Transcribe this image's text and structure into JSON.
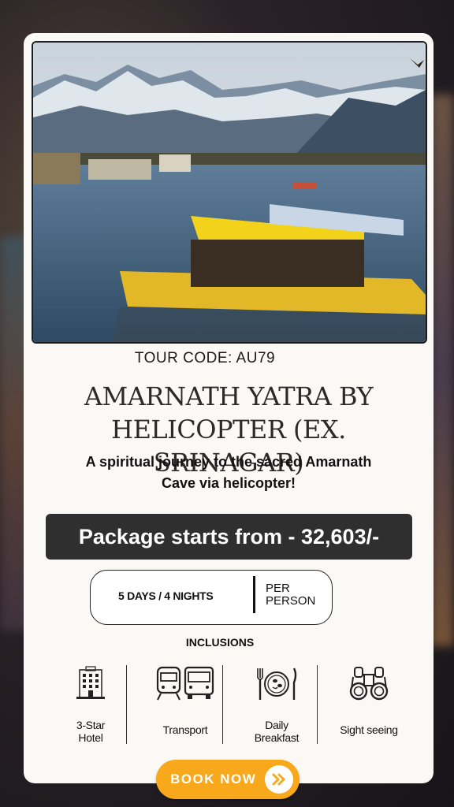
{
  "tour_code": "TOUR CODE: AU79",
  "title_line1": "AMARNATH YATRA BY",
  "title_line2": "HELICOPTER (EX. SRINAGAR)",
  "subtitle_line1": "A spiritual journey to the sacred Amarnath",
  "subtitle_line2": "Cave via helicopter!",
  "price_text": "Package starts from - 32,603/-",
  "duration": "5 DAYS / 4 NIGHTS",
  "per_line1": "PER",
  "per_line2": "PERSON",
  "inclusions_heading": "INCLUSIONS",
  "inclusions": [
    {
      "label_line1": "3-Star",
      "label_line2": "Hotel",
      "icon": "hotel-icon"
    },
    {
      "label_line1": "Transport",
      "label_line2": "",
      "icon": "transport-icon"
    },
    {
      "label_line1": "Daily",
      "label_line2": "Breakfast",
      "icon": "breakfast-icon"
    },
    {
      "label_line1": "Sight seeing",
      "label_line2": "",
      "icon": "binoculars-icon"
    }
  ],
  "book_button": "BOOK NOW",
  "colors": {
    "accent": "#f7a81b",
    "price_bar": "#2f2f2f",
    "card": "#fbf9f6"
  }
}
